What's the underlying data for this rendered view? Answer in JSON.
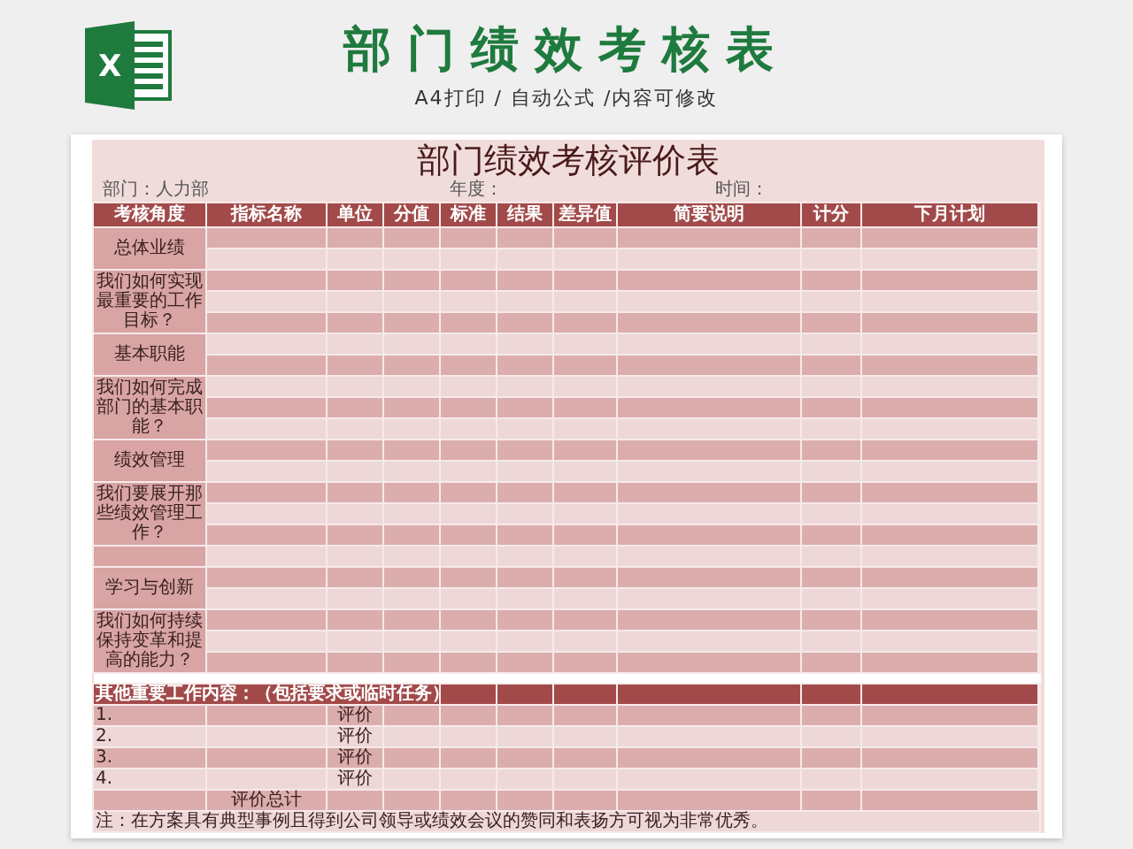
{
  "banner": {
    "logo_letter": "X",
    "title": "部门绩效考核表",
    "subtitle": "A4打印 / 自动公式 /内容可修改"
  },
  "sheet": {
    "title": "部门绩效考核评价表",
    "info": [
      {
        "label": "部门：人力部"
      },
      {
        "label": "年度："
      },
      {
        "label": "时间："
      }
    ],
    "columns": [
      "考核角度",
      "指标名称",
      "单位",
      "分值",
      "标准",
      "结果",
      "差异值",
      "简要说明",
      "计分",
      "下月计划"
    ],
    "categories": [
      {
        "kind": "heading",
        "label": "总体业绩"
      },
      {
        "kind": "question",
        "label": "我们如何实现最重要的工作目标？"
      },
      {
        "kind": "heading",
        "label": "基本职能"
      },
      {
        "kind": "question",
        "label": "我们如何完成部门的基本职能？"
      },
      {
        "kind": "heading",
        "label": "绩效管理"
      },
      {
        "kind": "question",
        "label": "我们要展开那些绩效管理工作？"
      },
      {
        "kind": "spacer"
      },
      {
        "kind": "heading",
        "label": "学习与创新"
      },
      {
        "kind": "question",
        "label": "我们如何持续保持变革和提高的能力？"
      }
    ],
    "other_tasks": {
      "heading": "其他重要工作内容：（包括要求或临时任务）",
      "items": [
        {
          "number": "1.",
          "rating_label": "评价"
        },
        {
          "number": "2.",
          "rating_label": "评价"
        },
        {
          "number": "3.",
          "rating_label": "评价"
        },
        {
          "number": "4.",
          "rating_label": "评价"
        }
      ],
      "total_label": "评价总计",
      "note": "注：在方案具有典型事例且得到公司领导或绩效会议的赞同和表扬方可视为非常优秀。"
    }
  }
}
